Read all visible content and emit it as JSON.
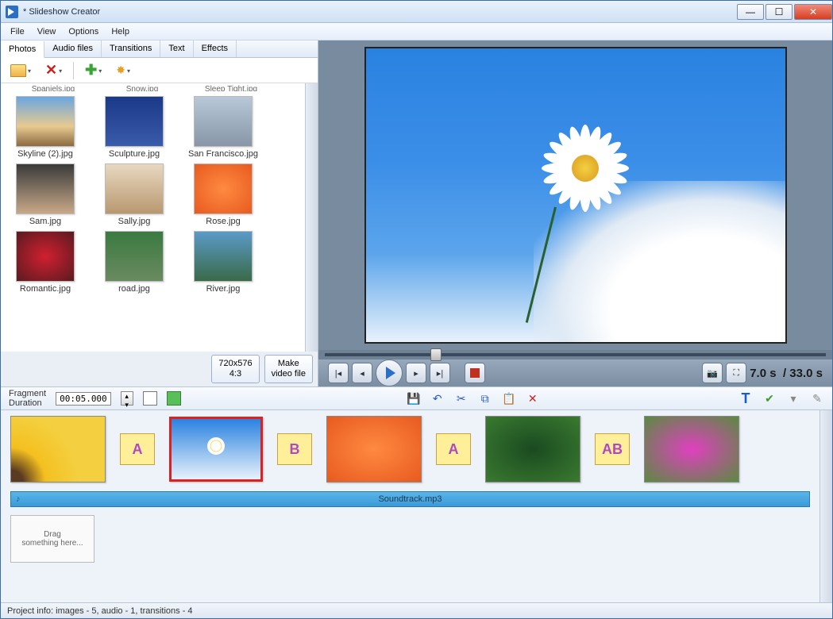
{
  "window": {
    "title": "* Slideshow Creator"
  },
  "menu": [
    "File",
    "View",
    "Options",
    "Help"
  ],
  "tabs": [
    "Photos",
    "Audio files",
    "Transitions",
    "Text",
    "Effects"
  ],
  "active_tab": 0,
  "gallery_truncated": [
    "Spaniels.jpg",
    "Snow.jpg",
    "Sleep Tight.jpg"
  ],
  "gallery": [
    {
      "label": "Skyline (2).jpg",
      "cls": "sky-thumb"
    },
    {
      "label": "Sculpture.jpg",
      "cls": "sculpt-thumb"
    },
    {
      "label": "San Francisco.jpg",
      "cls": "sf-thumb"
    },
    {
      "label": "Sam.jpg",
      "cls": "person-thumb"
    },
    {
      "label": "Sally.jpg",
      "cls": "person2-thumb"
    },
    {
      "label": "Rose.jpg",
      "cls": "rose-thumb"
    },
    {
      "label": "Romantic.jpg",
      "cls": "romantic-thumb"
    },
    {
      "label": "road.jpg",
      "cls": "road-thumb"
    },
    {
      "label": "River.jpg",
      "cls": "river-thumb"
    }
  ],
  "res_button": {
    "line1": "720x576",
    "line2": "4:3"
  },
  "make_video_button": {
    "line1": "Make",
    "line2": "video file"
  },
  "playback": {
    "current": "7.0 s",
    "sep": "/",
    "total": "33.0 s"
  },
  "fragment": {
    "label": "Fragment\nDuration",
    "value": "00:05.000"
  },
  "timeline": [
    {
      "type": "img",
      "cls": "sunflower-thumb"
    },
    {
      "type": "trans",
      "label": "A"
    },
    {
      "type": "img",
      "cls": "daisy-thumb",
      "selected": true
    },
    {
      "type": "trans",
      "label": "B"
    },
    {
      "type": "img",
      "cls": "rose-thumb"
    },
    {
      "type": "trans",
      "label": "A"
    },
    {
      "type": "img",
      "cls": "leaves-thumb"
    },
    {
      "type": "trans",
      "label": "AB"
    },
    {
      "type": "img",
      "cls": "pinkflower-thumb"
    }
  ],
  "audio_track": "Soundtrack.mp3",
  "dropzone": "Drag\nsomething here...",
  "status": "Project info: images - 5, audio - 1, transitions - 4"
}
